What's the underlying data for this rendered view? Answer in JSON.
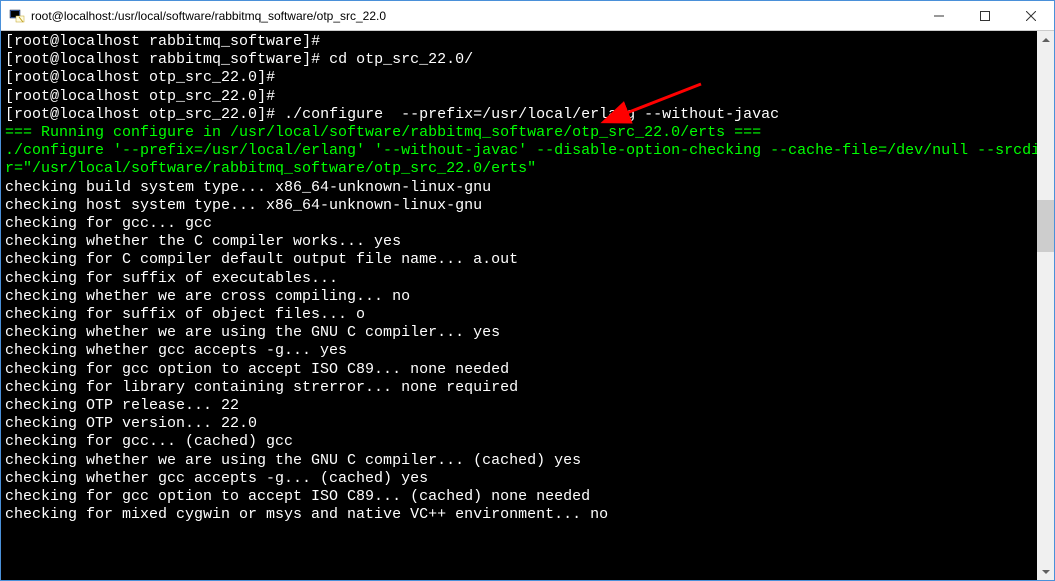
{
  "window": {
    "title": "root@localhost:/usr/local/software/rabbitmq_software/otp_src_22.0"
  },
  "terminal": {
    "lines": [
      {
        "segments": [
          {
            "t": "[",
            "c": "w"
          },
          {
            "t": "root@localhost rabbitmq_software",
            "c": "w"
          },
          {
            "t": "]#",
            "c": "w"
          }
        ]
      },
      {
        "segments": [
          {
            "t": "[",
            "c": "w"
          },
          {
            "t": "root@localhost rabbitmq_software",
            "c": "w"
          },
          {
            "t": "]# cd otp_src_22.0/",
            "c": "w"
          }
        ]
      },
      {
        "segments": [
          {
            "t": "[",
            "c": "w"
          },
          {
            "t": "root@localhost otp_src_22.0",
            "c": "w"
          },
          {
            "t": "]#",
            "c": "w"
          }
        ]
      },
      {
        "segments": [
          {
            "t": "[",
            "c": "w"
          },
          {
            "t": "root@localhost otp_src_22.0",
            "c": "w"
          },
          {
            "t": "]#",
            "c": "w"
          }
        ]
      },
      {
        "segments": [
          {
            "t": "[",
            "c": "w"
          },
          {
            "t": "root@localhost otp_src_22.0",
            "c": "w"
          },
          {
            "t": "]# ./configure  --prefix=/usr/local/erlang --without-javac",
            "c": "w"
          }
        ]
      },
      {
        "segments": [
          {
            "t": "=== Running configure in /usr/local/software/rabbitmq_software/otp_src_22.0/erts ===",
            "c": "g"
          }
        ]
      },
      {
        "segments": [
          {
            "t": "./configure '--prefix=/usr/local/erlang' '--without-javac' --disable-option-checking --cache-file=/dev/null --srcdir=\"/usr/local/software/rabbitmq_software/otp_src_22.0/erts\"",
            "c": "g"
          }
        ]
      },
      {
        "segments": [
          {
            "t": "checking build system type... x86_64-unknown-linux-gnu",
            "c": "w"
          }
        ]
      },
      {
        "segments": [
          {
            "t": "checking host system type... x86_64-unknown-linux-gnu",
            "c": "w"
          }
        ]
      },
      {
        "segments": [
          {
            "t": "checking for gcc... gcc",
            "c": "w"
          }
        ]
      },
      {
        "segments": [
          {
            "t": "checking whether the C compiler works... yes",
            "c": "w"
          }
        ]
      },
      {
        "segments": [
          {
            "t": "checking for C compiler default output file name... a.out",
            "c": "w"
          }
        ]
      },
      {
        "segments": [
          {
            "t": "checking for suffix of executables...",
            "c": "w"
          }
        ]
      },
      {
        "segments": [
          {
            "t": "checking whether we are cross compiling... no",
            "c": "w"
          }
        ]
      },
      {
        "segments": [
          {
            "t": "checking for suffix of object files... o",
            "c": "w"
          }
        ]
      },
      {
        "segments": [
          {
            "t": "checking whether we are using the GNU C compiler... yes",
            "c": "w"
          }
        ]
      },
      {
        "segments": [
          {
            "t": "checking whether gcc accepts -g... yes",
            "c": "w"
          }
        ]
      },
      {
        "segments": [
          {
            "t": "checking for gcc option to accept ISO C89... none needed",
            "c": "w"
          }
        ]
      },
      {
        "segments": [
          {
            "t": "checking for library containing strerror... none required",
            "c": "w"
          }
        ]
      },
      {
        "segments": [
          {
            "t": "checking OTP release... 22",
            "c": "w"
          }
        ]
      },
      {
        "segments": [
          {
            "t": "checking OTP version... 22.0",
            "c": "w"
          }
        ]
      },
      {
        "segments": [
          {
            "t": "checking for gcc... (cached) gcc",
            "c": "w"
          }
        ]
      },
      {
        "segments": [
          {
            "t": "checking whether we are using the GNU C compiler... (cached) yes",
            "c": "w"
          }
        ]
      },
      {
        "segments": [
          {
            "t": "checking whether gcc accepts -g... (cached) yes",
            "c": "w"
          }
        ]
      },
      {
        "segments": [
          {
            "t": "checking for gcc option to accept ISO C89... (cached) none needed",
            "c": "w"
          }
        ]
      },
      {
        "segments": [
          {
            "t": "checking for mixed cygwin or msys and native VC++ environment... no",
            "c": "w"
          }
        ]
      }
    ]
  },
  "arrow_color": "#ff0000"
}
